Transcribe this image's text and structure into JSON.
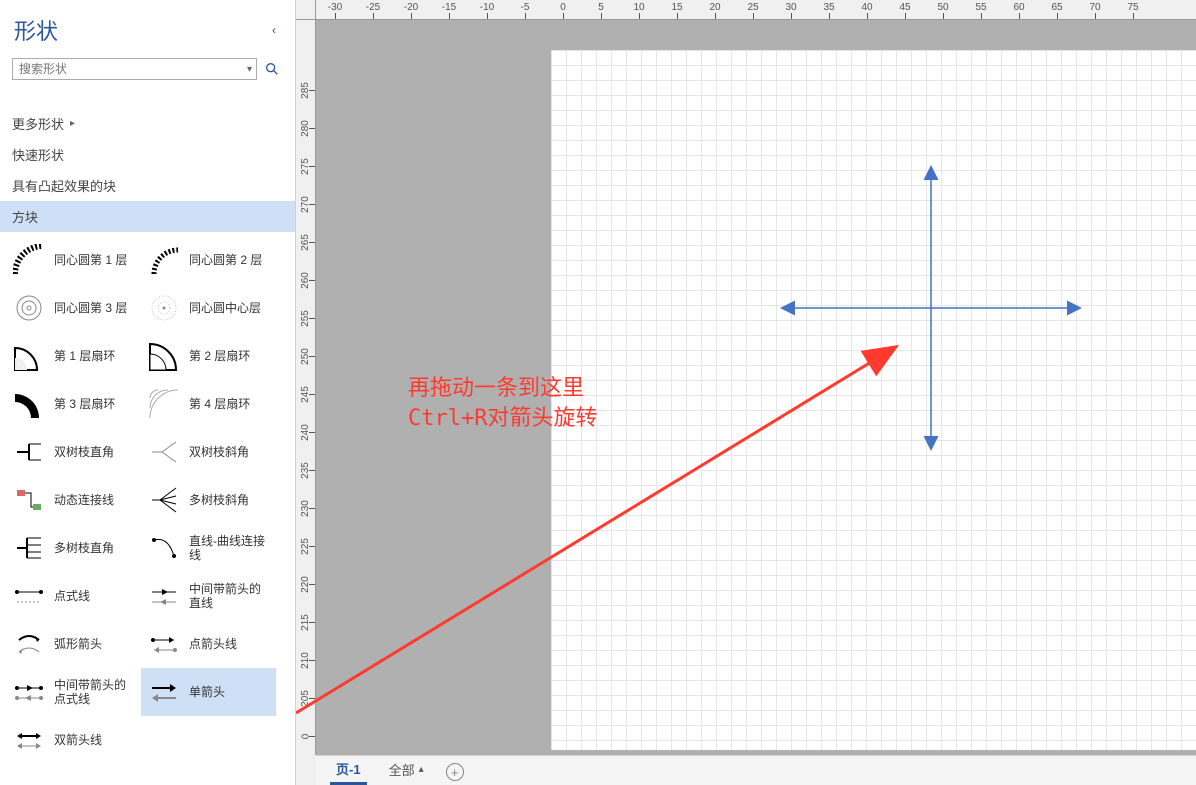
{
  "sidebar": {
    "title": "形状",
    "search_placeholder": "搜索形状",
    "more_shapes": "更多形状",
    "categories": [
      {
        "label": "快速形状"
      },
      {
        "label": "具有凸起效果的块"
      },
      {
        "label": "方块"
      }
    ],
    "shapes": [
      {
        "label": "同心圆第 1 层"
      },
      {
        "label": "同心圆第 2 层"
      },
      {
        "label": "同心圆第 3 层"
      },
      {
        "label": "同心圆中心层"
      },
      {
        "label": "第 1 层扇环"
      },
      {
        "label": "第 2 层扇环"
      },
      {
        "label": "第 3 层扇环"
      },
      {
        "label": "第 4 层扇环"
      },
      {
        "label": "双树枝直角"
      },
      {
        "label": "双树枝斜角"
      },
      {
        "label": "动态连接线"
      },
      {
        "label": "多树枝斜角"
      },
      {
        "label": "多树枝直角"
      },
      {
        "label": "直线-曲线连接线"
      },
      {
        "label": "点式线"
      },
      {
        "label": "中间带箭头的直线"
      },
      {
        "label": "弧形箭头"
      },
      {
        "label": "点箭头线"
      },
      {
        "label": "中间带箭头的点式线"
      },
      {
        "label": "单箭头"
      },
      {
        "label": "双箭头线"
      }
    ],
    "selected_shape_index": 19
  },
  "ruler": {
    "h": [
      "-30",
      "-25",
      "-20",
      "-15",
      "-10",
      "-5",
      "0",
      "5",
      "10",
      "15",
      "20",
      "25",
      "30",
      "35",
      "40",
      "45",
      "50",
      "55",
      "60",
      "65",
      "70",
      "75"
    ],
    "v": [
      "0",
      "205",
      "210",
      "215",
      "220",
      "225",
      "230",
      "235",
      "240",
      "245",
      "250",
      "255",
      "260",
      "265",
      "270",
      "275",
      "280",
      "285"
    ]
  },
  "annotation": {
    "line1": "再拖动一条到这里",
    "line2": "Ctrl+R对箭头旋转"
  },
  "tabs": {
    "page": "页-1",
    "all": "全部",
    "add_tooltip": "+"
  },
  "colors": {
    "accent": "#2b579a",
    "annotation": "#ff3b30",
    "arrow_blue": "#4472c4"
  }
}
